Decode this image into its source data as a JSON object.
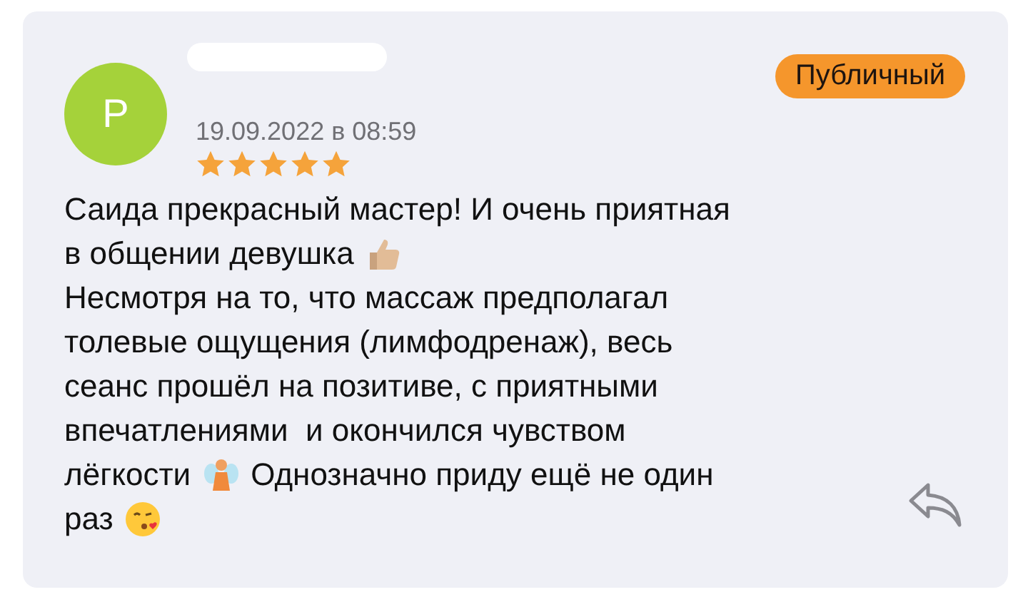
{
  "review": {
    "avatar_letter": "P",
    "date": "19.09.2022 в 08:59",
    "stars": 5,
    "badge": "Публичный",
    "lines": [
      [
        {
          "kind": "text",
          "text": "Саида прекрасный мастер! И очень приятная"
        }
      ],
      [
        {
          "kind": "text",
          "text": "в общении девушка"
        },
        {
          "kind": "thumbs_up"
        }
      ],
      [
        {
          "kind": "text",
          "text": "Несмотря на то, что массаж предполагал"
        }
      ],
      [
        {
          "kind": "text",
          "text": "толевые ощущения (лимфодренаж), весь"
        }
      ],
      [
        {
          "kind": "text",
          "text": "сеанс прошёл на позитиве, с приятными"
        }
      ],
      [
        {
          "kind": "text",
          "text": "впечатлениями  и окончился чувством"
        }
      ],
      [
        {
          "kind": "text",
          "text": "лёгкости"
        },
        {
          "kind": "fairy"
        },
        {
          "kind": "text",
          "text": "Однозначно приду ещё не один"
        }
      ],
      [
        {
          "kind": "text",
          "text": "раз"
        },
        {
          "kind": "kiss"
        }
      ]
    ]
  }
}
